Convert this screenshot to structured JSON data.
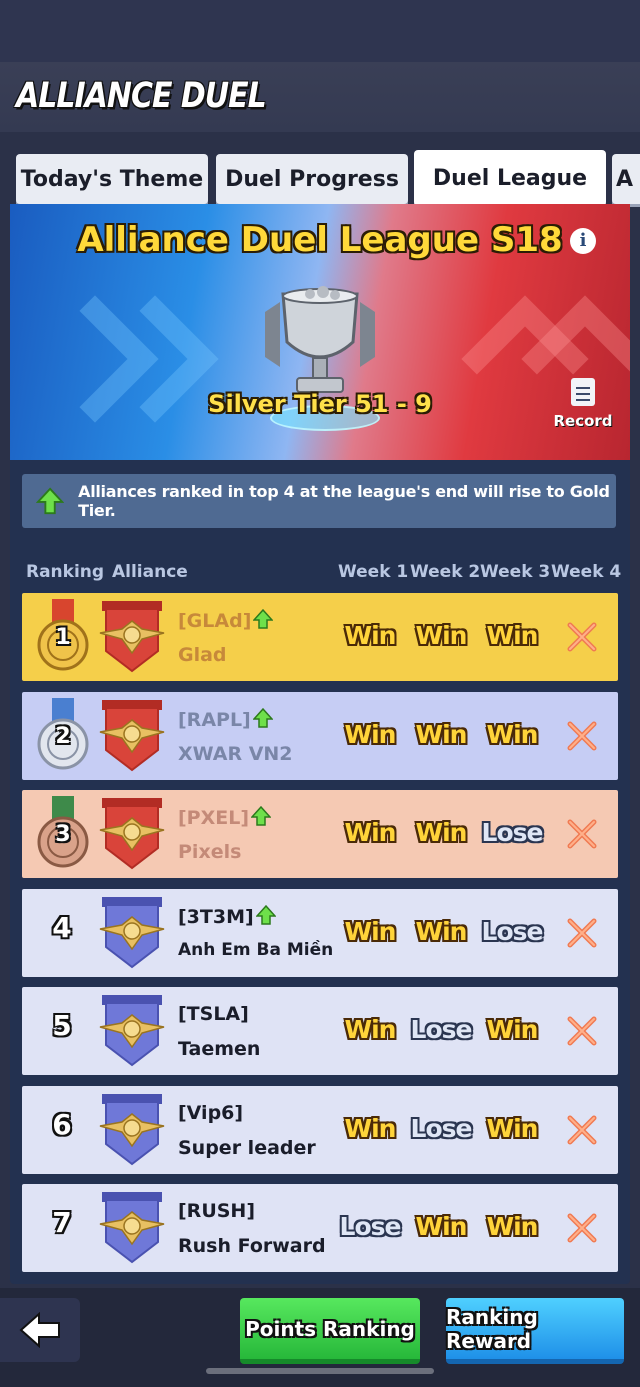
{
  "header": {
    "title": "ALLIANCE DUEL"
  },
  "tabs": [
    {
      "label": "Today's Theme",
      "active": false
    },
    {
      "label": "Duel Progress",
      "active": false
    },
    {
      "label": "Duel League",
      "active": true
    },
    {
      "label": "A",
      "active": false
    }
  ],
  "banner": {
    "title": "Alliance Duel League S18",
    "tier": "Silver Tier 51 - 9",
    "record_label": "Record"
  },
  "notice": "Alliances ranked in top 4 at the league's end will rise to Gold Tier.",
  "columns": {
    "ranking": "Ranking",
    "alliance": "Alliance",
    "week1": "Week 1",
    "week2": "Week 2",
    "week3": "Week 3",
    "week4": "Week 4"
  },
  "rows": [
    {
      "rank": "1",
      "tag": "[GLAd]",
      "promote": true,
      "name": "Glad",
      "results": [
        "Win",
        "Win",
        "Win"
      ],
      "bg": "#f5cf4a",
      "tag_color": "#c7893a",
      "name_color": "#c7893a"
    },
    {
      "rank": "2",
      "tag": "[RAPL]",
      "promote": true,
      "name": "XWAR VN2",
      "results": [
        "Win",
        "Win",
        "Win"
      ],
      "bg": "#c6cdf4",
      "tag_color": "#7a86a8",
      "name_color": "#7a86a8"
    },
    {
      "rank": "3",
      "tag": "[PXEL]",
      "promote": true,
      "name": "Pixels",
      "results": [
        "Win",
        "Win",
        "Lose"
      ],
      "bg": "#f5c9b3",
      "tag_color": "#c48a78",
      "name_color": "#c48a78"
    },
    {
      "rank": "4",
      "tag": "[3T3M]",
      "promote": true,
      "name": "Anh Em Ba Miền",
      "results": [
        "Win",
        "Win",
        "Lose"
      ],
      "bg": "#dfe3f5",
      "tag_color": "#1a1d2a",
      "name_color": "#1a1d2a"
    },
    {
      "rank": "5",
      "tag": "[TSLA]",
      "promote": false,
      "name": "Taemen",
      "results": [
        "Win",
        "Lose",
        "Win"
      ],
      "bg": "#dfe3f5",
      "tag_color": "#1a1d2a",
      "name_color": "#1a1d2a"
    },
    {
      "rank": "6",
      "tag": "[Vip6]",
      "promote": false,
      "name": "Super leader",
      "results": [
        "Win",
        "Lose",
        "Win"
      ],
      "bg": "#dfe3f5",
      "tag_color": "#1a1d2a",
      "name_color": "#1a1d2a"
    },
    {
      "rank": "7",
      "tag": "[RUSH]",
      "promote": false,
      "name": "Rush Forward",
      "results": [
        "Lose",
        "Win",
        "Win"
      ],
      "bg": "#dfe3f5",
      "tag_color": "#1a1d2a",
      "name_color": "#1a1d2a"
    }
  ],
  "buttons": {
    "points_ranking": "Points Ranking",
    "ranking_reward": "Ranking Reward"
  },
  "icons": {
    "back": "back-arrow-icon",
    "info": "info-icon",
    "record": "clipboard-icon",
    "promote": "up-arrow-icon",
    "pending": "crossed-swords-icon"
  }
}
